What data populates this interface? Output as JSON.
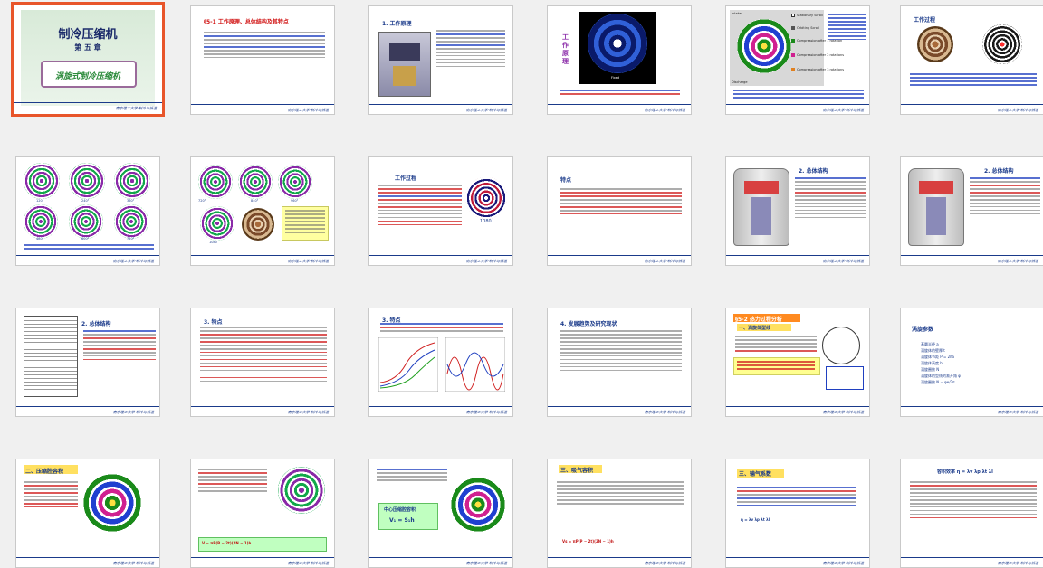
{
  "footer_text": "南京理工大学·制冷与低温",
  "slides": [
    {
      "id": 1,
      "chapter_title": "制冷压缩机",
      "chapter_no": "第 五 章",
      "subtitle": "涡旋式制冷压缩机"
    },
    {
      "id": 2,
      "title": "§5-1 工作原理、总体结构及其特点"
    },
    {
      "id": 3,
      "title": "1. 工作原理"
    },
    {
      "id": 4,
      "title": "工作原理",
      "label": "Fixed"
    },
    {
      "id": 5,
      "legend": [
        "Stationary Scroll",
        "Orbiting Scroll",
        "Compression after 1 rotation",
        "Compression after 2 rotations",
        "Compression after 3 rotations"
      ],
      "label_intake": "Intake",
      "label_discharge": "Discharge"
    },
    {
      "id": 6,
      "title": "工作过程"
    },
    {
      "id": 7,
      "angles": [
        "120°",
        "240°",
        "360°",
        "480°",
        "600°",
        "720°"
      ]
    },
    {
      "id": 8,
      "angles": [
        "720°",
        "840°",
        "960°",
        "1080"
      ]
    },
    {
      "id": 9,
      "title": "工作过程",
      "angle": "1080"
    },
    {
      "id": 10,
      "title": "特点"
    },
    {
      "id": 11,
      "title": "2. 总体结构"
    },
    {
      "id": 12,
      "title": "2. 总体结构"
    },
    {
      "id": 13,
      "title": "2. 总体结构"
    },
    {
      "id": 14,
      "title": "3. 特点"
    },
    {
      "id": 15,
      "title": "3. 特点"
    },
    {
      "id": 16,
      "title": "4. 发展趋势及研究现状"
    },
    {
      "id": 17,
      "title": "§5-2 热力过程分析",
      "subtitle": "一、涡旋体型线"
    },
    {
      "id": 18,
      "title": "涡旋参数",
      "params": [
        "基圆半径 a",
        "涡旋体的壁厚 t",
        "涡旋体节距 P = 2πa",
        "涡旋体高度 h",
        "涡旋圈数 N",
        "涡旋体的型线的渐开角 φ",
        "涡旋圈数 N = φe/2π"
      ]
    },
    {
      "id": 19,
      "title": "二、压缩腔容积"
    },
    {
      "id": 20,
      "title": "吸气腔容积",
      "formula": "V = πP(P − 2t)(2N − 1)h"
    },
    {
      "id": 21,
      "title": "中心压缩腔容积",
      "formula": "V₁ = S₁h"
    },
    {
      "id": 22,
      "title": "三、吸气容积",
      "formula": "Vs = πP(P − 2t)(2N − 1)h"
    },
    {
      "id": 23,
      "title": "三、输气系数",
      "formula": "η = λv λp λt λl"
    },
    {
      "id": 24,
      "title": "容积效率 η = λv λp λt λl"
    }
  ]
}
